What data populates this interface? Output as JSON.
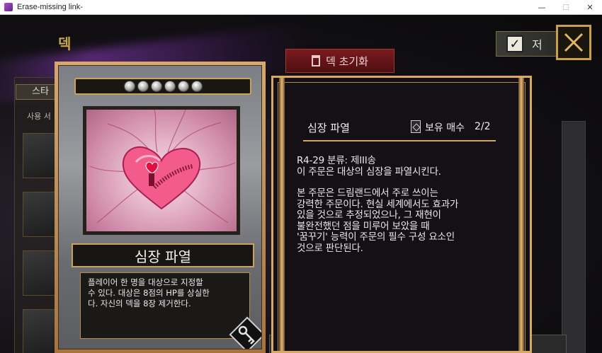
{
  "window": {
    "title": "Erase-missing link-",
    "minimize": "—",
    "maximize": "☐",
    "close": "✕"
  },
  "background": {
    "screen_title": "덱",
    "tab_label": "스타",
    "sub_label": "사용 서",
    "reset_button": "덱 초기화",
    "checkbox_label": "저",
    "checkbox_checked": true
  },
  "card": {
    "gems": 6,
    "name": "심장 파열",
    "description_lines": [
      "플레이어 한 명을 대상으로 지정할",
      "수 있다. 대상은 8점의 HP를 상실한",
      "다. 자신의 덱을 8장 제거한다."
    ]
  },
  "detail": {
    "title": "심장 파열",
    "owned_label": "보유 매수",
    "owned_count": "2/2",
    "classification": "R4-29 분류: 제III송",
    "effect": "이 주문은 대상의 심장을 파열시킨다.",
    "lore_lines": [
      "본 주문은 드림랜드에서 주로 쓰이는",
      "강력한 주문이다. 현실 세계에서도 효과가",
      "있을 것으로 추정되었으나, 그 재현이",
      "불완전했던 점을 미루어 보았을 때",
      "'꿈꾸기' 능력이 주문의 필수 구성 요소인",
      "것으로 판단된다."
    ]
  },
  "colors": {
    "gold": "#d9a862",
    "panel_bg": "#141016",
    "reset_red": "#7a1a1e"
  }
}
